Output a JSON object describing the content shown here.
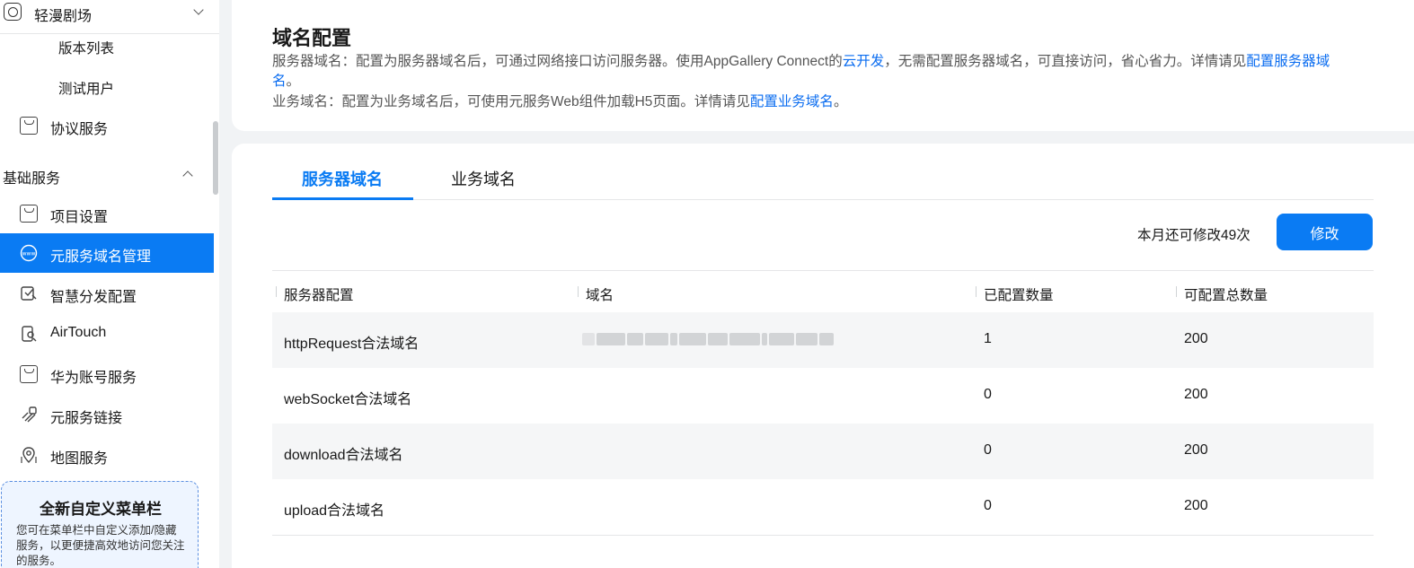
{
  "sidebar": {
    "app_name": "轻漫剧场",
    "sub_items": [
      "版本列表",
      "测试用户"
    ],
    "protocol_service": "协议服务",
    "group_title": "基础服务",
    "items": [
      {
        "label": "项目设置"
      },
      {
        "label": "元服务域名管理",
        "active": true
      },
      {
        "label": "智慧分发配置"
      },
      {
        "label": "AirTouch"
      },
      {
        "label": "华为账号服务"
      },
      {
        "label": "元服务链接"
      },
      {
        "label": "地图服务"
      }
    ],
    "promo": {
      "title": "全新自定义菜单栏",
      "desc": "您可在菜单栏中自定义添加/隐藏服务，以更便捷高效地访问您关注的服务。"
    }
  },
  "header": {
    "title": "域名配置",
    "desc1_prefix": "服务器域名：配置为服务器域名后，可通过网络接口访问服务器。使用AppGallery Connect的",
    "desc1_link1": "云开发",
    "desc1_mid": "，无需配置服务器域名，可直接访问，省心省力。详情请见",
    "desc1_link2_a": "配置服务器域",
    "desc1_link2_b": "名",
    "desc1_end": "。",
    "desc2_prefix": "业务域名：配置为业务域名后，可使用元服务Web组件加载H5页面。详情请见",
    "desc2_link": "配置业务域名",
    "desc2_end": "。"
  },
  "tabs": [
    {
      "label": "服务器域名",
      "active": true
    },
    {
      "label": "业务域名",
      "active": false
    }
  ],
  "toolbar": {
    "quota_text": "本月还可修改49次",
    "modify_label": "修改"
  },
  "table": {
    "headers": [
      "服务器配置",
      "域名",
      "已配置数量",
      "可配置总数量"
    ],
    "rows": [
      {
        "config": "httpRequest合法域名",
        "domain": "",
        "configured": "1",
        "total": "200"
      },
      {
        "config": "webSocket合法域名",
        "domain": "",
        "configured": "0",
        "total": "200"
      },
      {
        "config": "download合法域名",
        "domain": "",
        "configured": "0",
        "total": "200"
      },
      {
        "config": "upload合法域名",
        "domain": "",
        "configured": "0",
        "total": "200"
      }
    ]
  },
  "colors": {
    "accent": "#0a7bf3",
    "link": "#0a6cf0"
  }
}
